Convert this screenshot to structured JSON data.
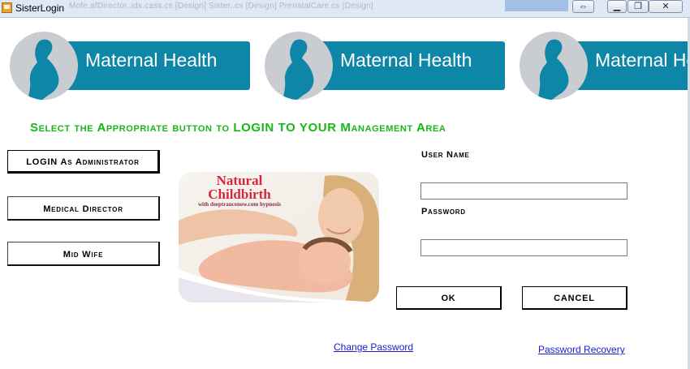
{
  "window": {
    "title": "SisterLogin",
    "background_tabs": "Mofe.afDirector..ids.cass.cs [Design]      Sister..cs [Design]      PrenatalCare.cs [Design]"
  },
  "banners": [
    {
      "text": "Maternal Health"
    },
    {
      "text": "Maternal Health"
    },
    {
      "text": "Maternal Health"
    }
  ],
  "instruction": "Select the Appropriate button to LOGIN TO YOUR Management Area",
  "roles": {
    "admin": "LOGIN As Administrator",
    "medical_director": "Medical Director",
    "midwife": "Mid Wife"
  },
  "picture": {
    "line1": "Natural",
    "line2": "Childbirth",
    "line3": "with deeptrancenow.com hypnosis"
  },
  "login": {
    "username_label": "User Name",
    "username_value": "",
    "password_label": "Password",
    "password_value": ""
  },
  "actions": {
    "ok": "OK",
    "cancel": "CANCEL"
  },
  "links": {
    "change_password": "Change Password",
    "password_recovery": "Password Recovery"
  },
  "colors": {
    "banner_blue": "#0e86a8",
    "heading_green": "#17b717",
    "link_blue": "#1a1ad0"
  }
}
